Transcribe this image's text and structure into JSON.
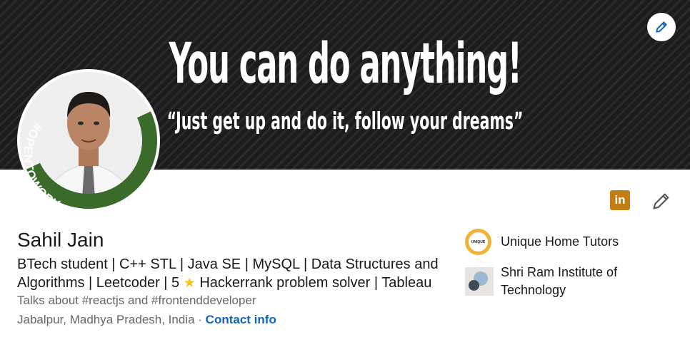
{
  "banner": {
    "headline": "You can do anything!",
    "quote": "“Just get up and do it, follow your dreams”"
  },
  "profile": {
    "badge": "#OPENTOWORK",
    "name": "Sahil Jain",
    "headline_line1": "BTech student | C++ STL | Java SE | MySQL | Data Structures and",
    "headline_line2_a": "Algorithms | Leetcoder | 5",
    "headline_line2_b": "Hackerrank problem solver | Tableau",
    "talks_about": "Talks about #reactjs and #frontenddeveloper",
    "location": "Jabalpur, Madhya Pradesh, India ·",
    "contact_label": "Contact info"
  },
  "organizations": [
    {
      "name": "Unique Home Tutors",
      "logo_text": "UNIQUE"
    },
    {
      "name_line1": "Shri Ram Institute of",
      "name_line2": "Technology"
    }
  ],
  "colors": {
    "link": "#0a66c2",
    "linkedin_badge": "#c37d16",
    "open_to_work": "#3a6b2a"
  },
  "icons": [
    "pencil-icon",
    "linkedin-icon",
    "star-icon"
  ]
}
